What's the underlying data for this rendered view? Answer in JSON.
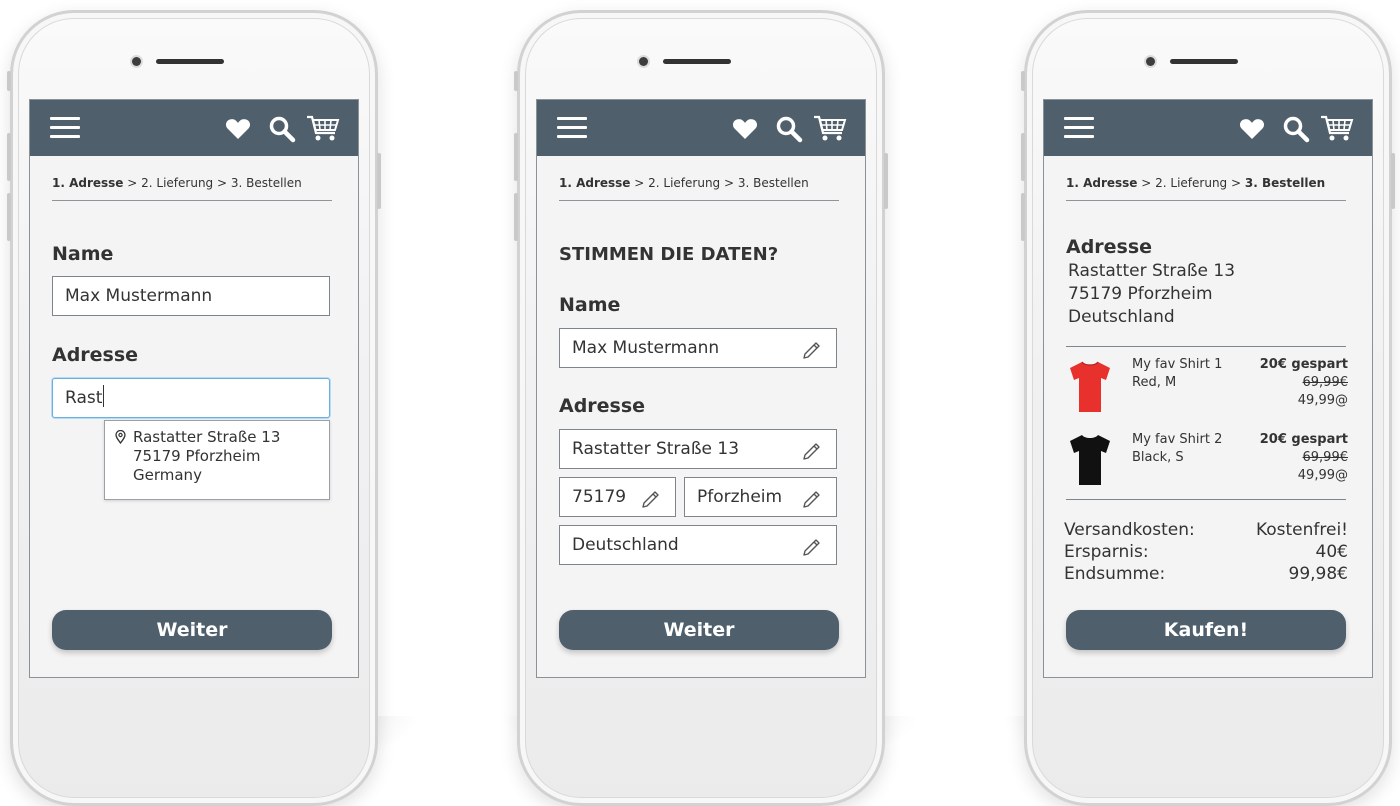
{
  "breadcrumb": {
    "step1": "1. Adresse",
    "sep1": " > ",
    "step2": "2. Lieferung",
    "sep2": " > ",
    "step3": "3. Bestellen"
  },
  "icons": {
    "menu": "hamburger-menu-icon",
    "favorites": "heart-icon",
    "search": "search-icon",
    "cart": "cart-icon"
  },
  "colors": {
    "appbar": "#4f5f6c",
    "button": "#4f5f6c",
    "focus": "#6ab0e0"
  },
  "screen1": {
    "name_label": "Name",
    "name_value": "Max Mustermann",
    "address_label": "Adresse",
    "address_value": "Rast",
    "suggestion": {
      "street": "Rastatter Straße 13",
      "city": "75179 Pforzheim",
      "country": "Germany"
    },
    "button": "Weiter"
  },
  "screen2": {
    "heading": "STIMMEN DIE DATEN?",
    "name_label": "Name",
    "name_value": "Max Mustermann",
    "address_label": "Adresse",
    "street": "Rastatter Straße 13",
    "zip": "75179",
    "city": "Pforzheim",
    "country": "Deutschland",
    "button": "Weiter"
  },
  "screen3": {
    "address_title": "Adresse",
    "address_lines": [
      "Rastatter Straße 13",
      "75179 Pforzheim",
      "Deutschland"
    ],
    "items": [
      {
        "name": "My fav Shirt 1",
        "variant": "Red, M",
        "saved": "20€ gespart",
        "old_price": "69,99€",
        "price": "49,99@",
        "color": "#e8312c"
      },
      {
        "name": "My fav Shirt 2",
        "variant": "Black, S",
        "saved": "20€ gespart",
        "old_price": "69,99€",
        "price": "49,99@",
        "color": "#111111"
      }
    ],
    "totals": [
      {
        "label": "Versandkosten:",
        "value": "Kostenfrei!"
      },
      {
        "label": "Ersparnis:",
        "value": "40€"
      },
      {
        "label": "Endsumme:",
        "value": "99,98€"
      }
    ],
    "button": "Kaufen!"
  }
}
